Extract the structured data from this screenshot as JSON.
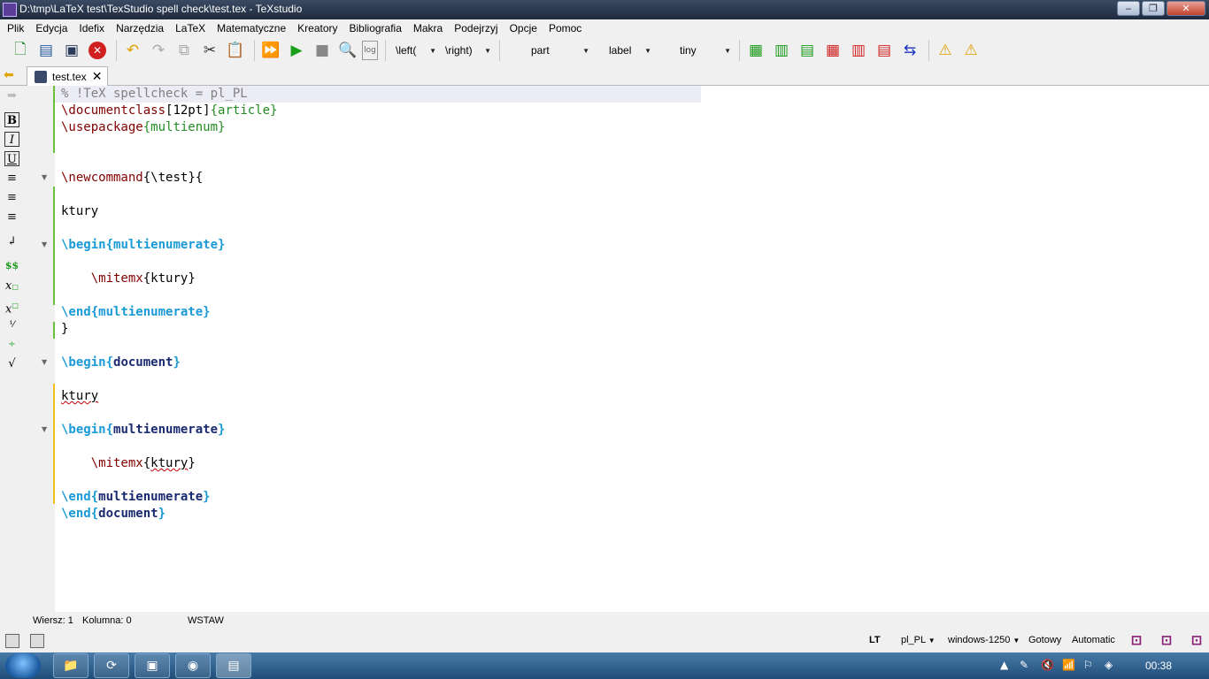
{
  "window": {
    "title": "D:\\tmp\\LaTeX test\\TexStudio spell check\\test.tex - TeXstudio",
    "minimize": "‒",
    "maximize": "❐",
    "close": "✕"
  },
  "menu": [
    "Plik",
    "Edycja",
    "Idefix",
    "Narzędzia",
    "LaTeX",
    "Matematyczne",
    "Kreatory",
    "Bibliografia",
    "Makra",
    "Podejrzyj",
    "Opcje",
    "Pomoc"
  ],
  "toolbar": {
    "combo_left": "\\left(",
    "combo_right": "\\right)",
    "combo_part": "part",
    "combo_label": "label",
    "combo_size": "tiny"
  },
  "tab": {
    "label": "test.tex"
  },
  "editor": {
    "lines": {
      "l1": "% !TeX spellcheck = pl_PL",
      "l2_cmd": "\\documentclass",
      "l2_opt": "[12pt]",
      "l2_arg": "article",
      "l3_cmd": "\\usepackage",
      "l3_arg": "multienum",
      "l6_cmd": "\\newcommand",
      "l6_arg": "\\test",
      "l8": "ktury",
      "l10_kw": "\\begin",
      "l10_arg": "multienumerate",
      "l12_cmd": "\\mitemx",
      "l12_arg": "ktury",
      "l14_kw": "\\end",
      "l14_arg": "multienumerate",
      "l15": "}",
      "l17_kw": "\\begin",
      "l17_arg": "document",
      "l19": "ktury",
      "l21_kw": "\\begin",
      "l21_arg": "multienumerate",
      "l23_cmd": "\\mitemx",
      "l23_arg": "ktury",
      "l25_kw": "\\end",
      "l25_arg": "multienumerate",
      "l26_kw": "\\end",
      "l26_arg": "document"
    }
  },
  "status": {
    "row": "Wiersz: 1",
    "col": "Kolumna: 0",
    "mode": "WSTAW",
    "lt": "LT",
    "lang": "pl_PL",
    "encoding": "windows-1250",
    "ready": "Gotowy",
    "auto": "Automatic"
  },
  "taskbar": {
    "clock": "00:38"
  }
}
